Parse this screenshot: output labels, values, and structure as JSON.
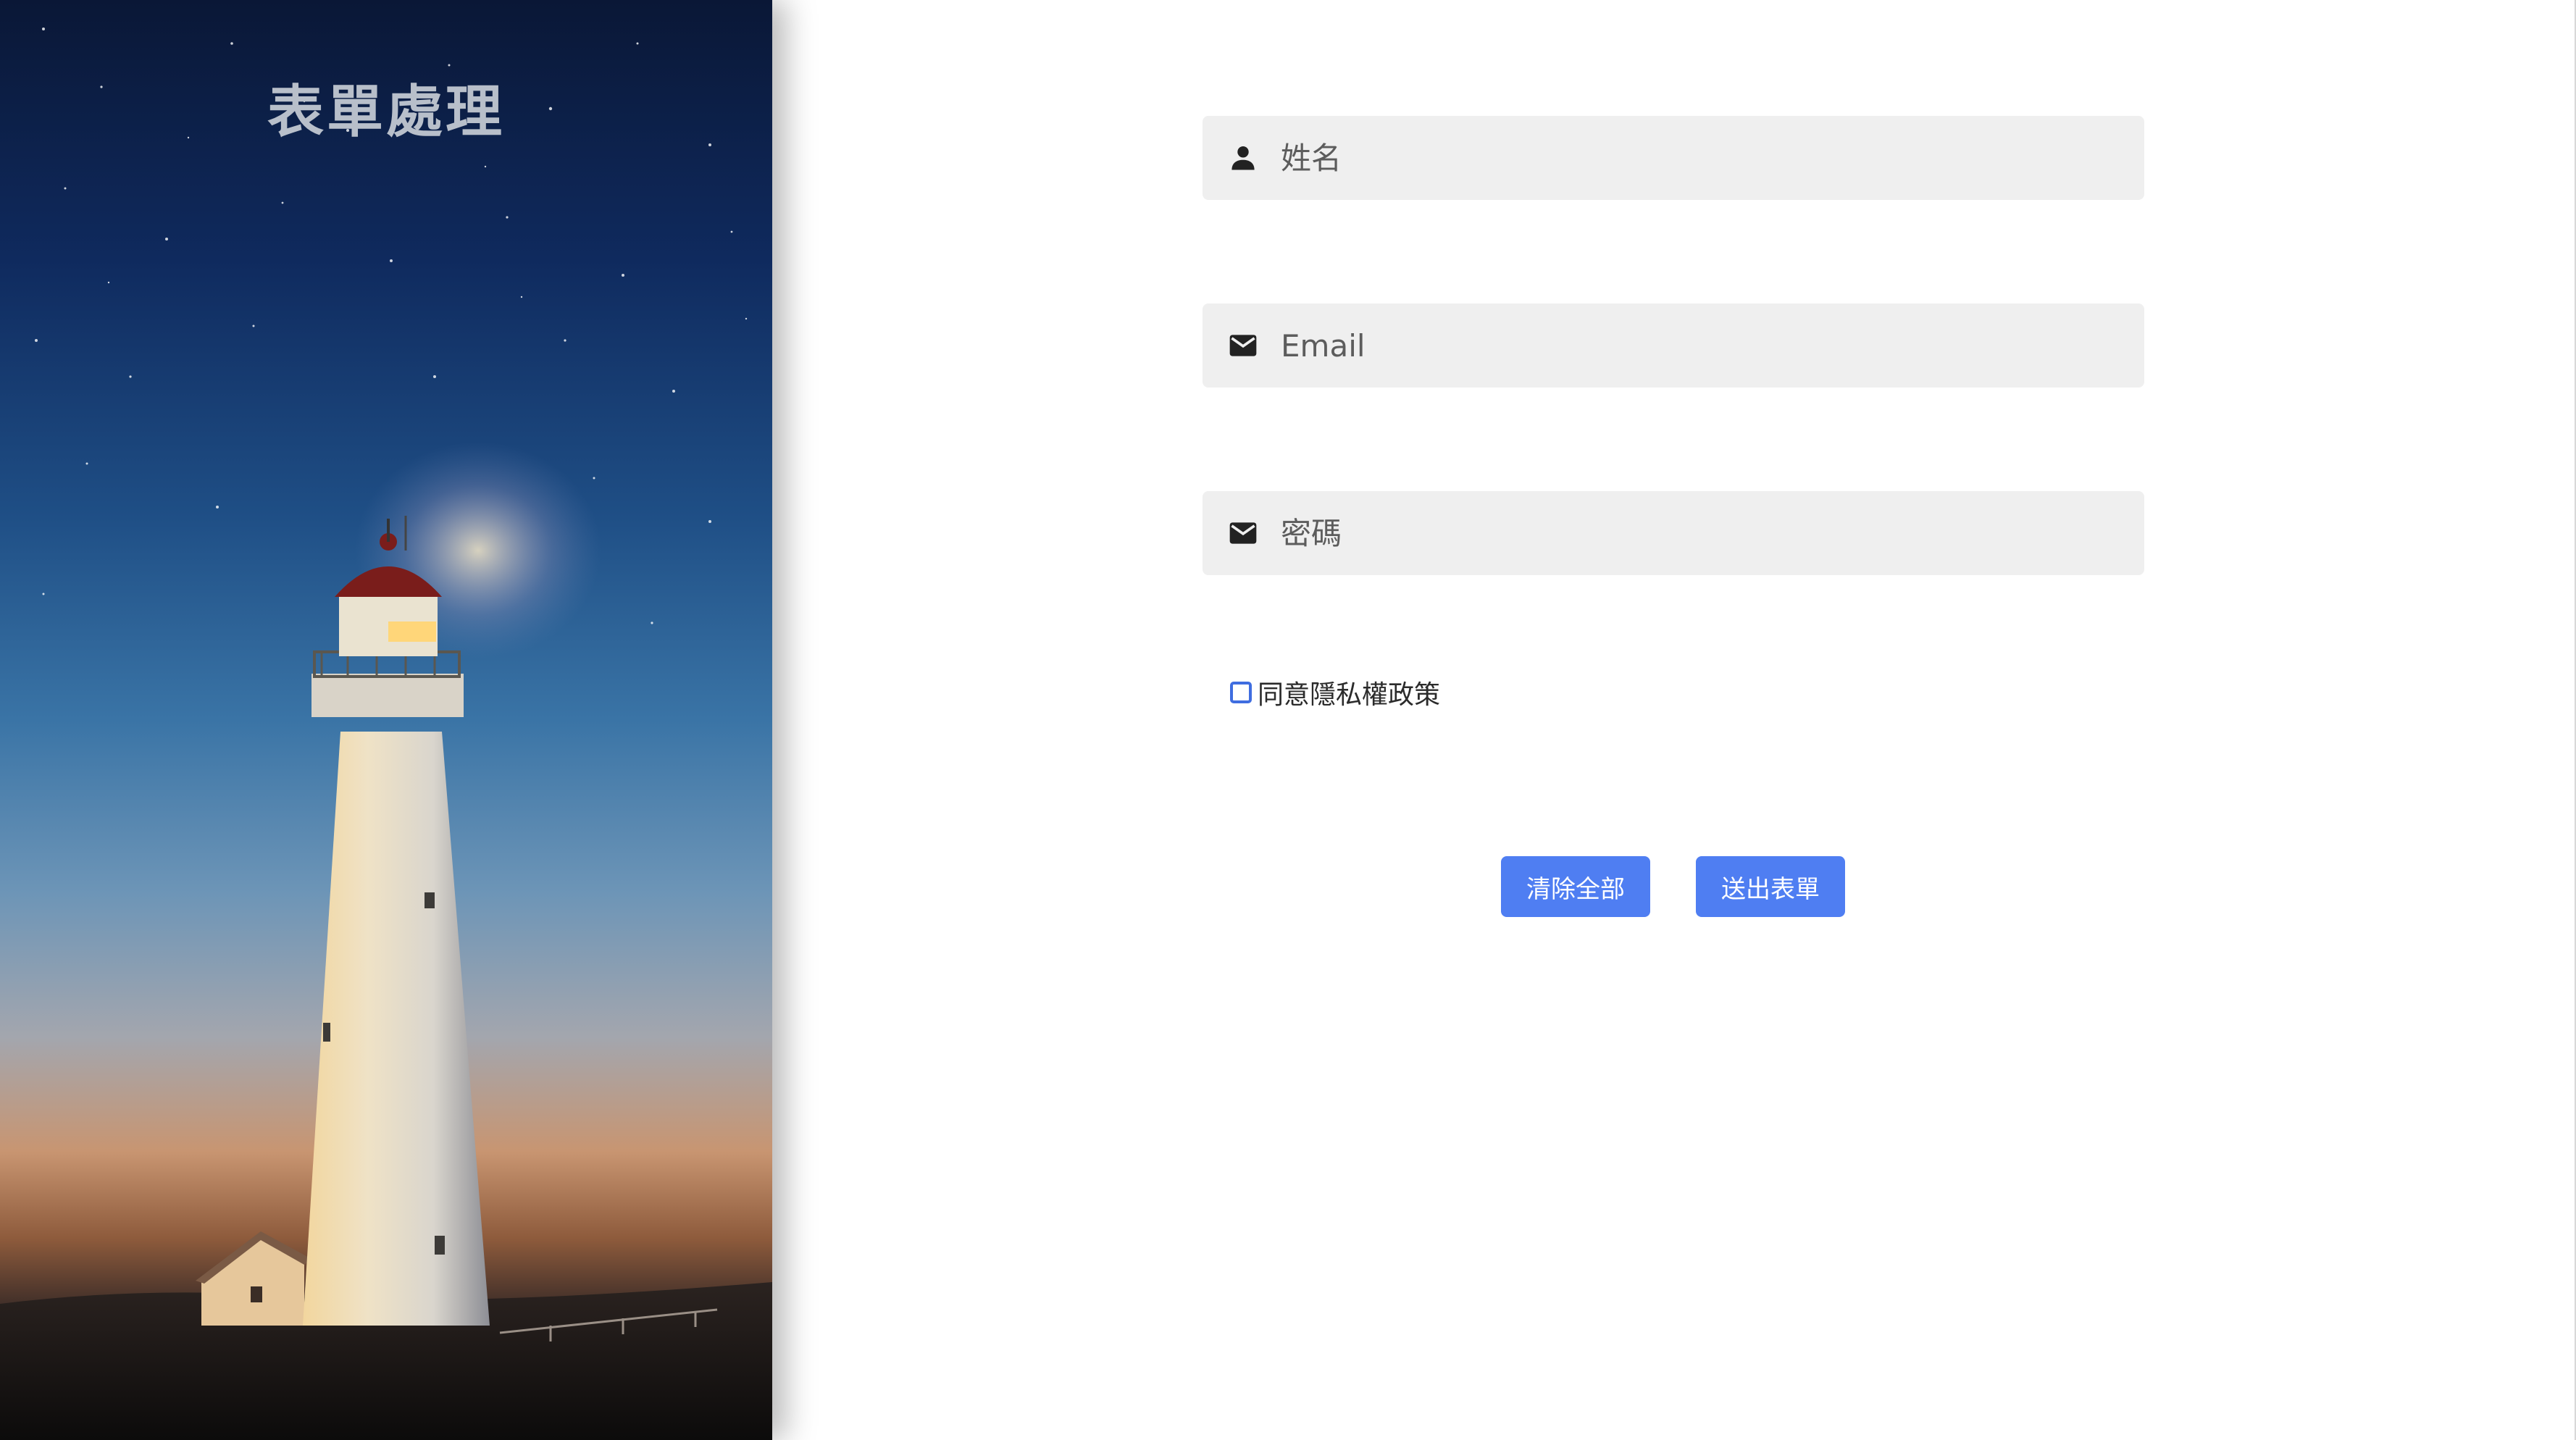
{
  "hero": {
    "title": "表單處理"
  },
  "form": {
    "fields": [
      {
        "icon": "person-icon",
        "placeholder": "姓名",
        "value": ""
      },
      {
        "icon": "mail-icon",
        "placeholder": "Email",
        "value": ""
      },
      {
        "icon": "mail-icon",
        "placeholder": "密碼",
        "value": ""
      }
    ],
    "agree_label": "同意隱私權政策",
    "agree_checked": false,
    "buttons": {
      "clear_label": "清除全部",
      "submit_label": "送出表單"
    }
  },
  "colors": {
    "button": "#4f7ef2",
    "field_bg": "#efefef",
    "checkbox_border": "#3f6de0",
    "title": "#b8bfca"
  }
}
